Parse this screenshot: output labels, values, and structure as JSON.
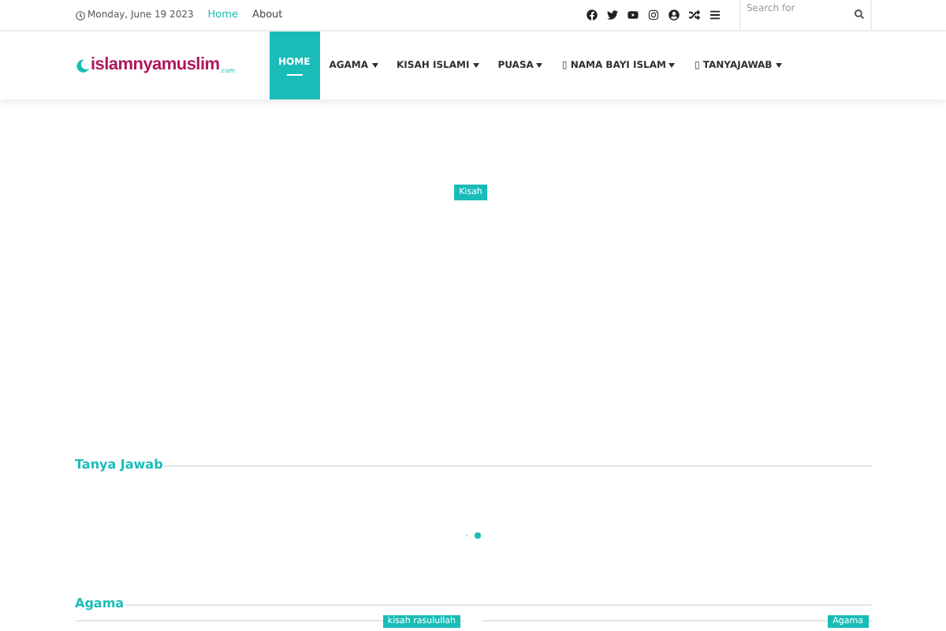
{
  "top_bar": {
    "date": "Monday, June 19 2023",
    "links": [
      {
        "label": "Home",
        "selected": true
      },
      {
        "label": "About",
        "selected": false
      }
    ],
    "search": {
      "placeholder": "Search for"
    }
  },
  "header": {
    "logo": {
      "main": "islamnyamuslim",
      "suffix": ".com"
    },
    "nav": [
      {
        "label": "HOME",
        "selected": true,
        "dropdown": false
      },
      {
        "label": "AGAMA",
        "selected": false,
        "dropdown": true
      },
      {
        "label": "KISAH ISLAMI",
        "selected": false,
        "dropdown": true
      },
      {
        "label": "PUASA",
        "selected": false,
        "dropdown": true
      },
      {
        "label": "▯ NAMA BAYI ISLAM",
        "selected": false,
        "dropdown": true
      },
      {
        "label": "▯ TANYAJAWAB",
        "selected": false,
        "dropdown": true
      }
    ]
  },
  "slider": {
    "badge": "Kisah"
  },
  "sections": [
    {
      "title": "Tanya Jawab"
    },
    {
      "title": "Agama",
      "badges": [
        "kisah rasulullah",
        "Agama"
      ]
    }
  ]
}
